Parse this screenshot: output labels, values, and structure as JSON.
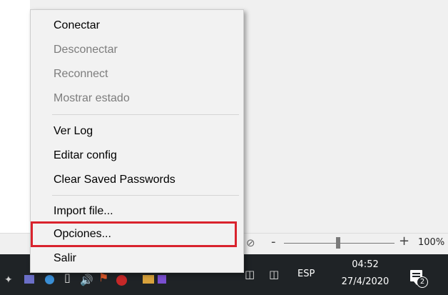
{
  "context_menu": {
    "items": [
      {
        "label": "Conectar",
        "enabled": true
      },
      {
        "label": "Desconectar",
        "enabled": false
      },
      {
        "label": "Reconnect",
        "enabled": false
      },
      {
        "label": "Mostrar estado",
        "enabled": false
      },
      {
        "label": "Ver Log",
        "enabled": true
      },
      {
        "label": "Editar config",
        "enabled": true
      },
      {
        "label": "Clear Saved Passwords",
        "enabled": true
      },
      {
        "label": "Import file...",
        "enabled": true
      },
      {
        "label": "Opciones...",
        "enabled": true,
        "highlighted": true
      },
      {
        "label": "Salir",
        "enabled": true
      }
    ],
    "highlight_color": "#d9232d"
  },
  "status_bar": {
    "zoom_minus": "-",
    "zoom_plus": "+",
    "zoom_percent": "100%",
    "zoom_level": 1.0
  },
  "taskbar": {
    "language": "ESP",
    "clock_time": "04:52",
    "clock_date": "27/4/2020",
    "notification_count": "2",
    "tray_icons": [
      "pin-icon",
      "app-icon",
      "shield-icon",
      "device-icon",
      "volume-icon",
      "flag-icon",
      "vpn-icon",
      "folder-icon",
      "network-icon",
      "monitor-icon",
      "ethernet-icon"
    ]
  }
}
